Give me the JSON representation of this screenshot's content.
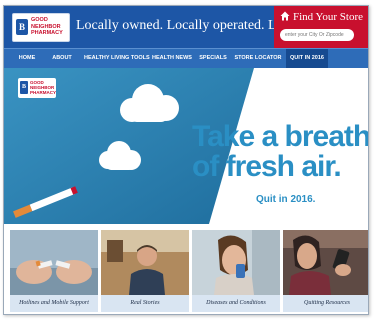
{
  "header": {
    "logo_lines": [
      "GOOD",
      "NEIGHBOR",
      "PHARMACY"
    ],
    "tagline": "Locally owned. Locally operated. Locally loved.",
    "store_finder": {
      "title": "Find Your Store",
      "placeholder": "enter your City Or Zipcode"
    }
  },
  "nav": {
    "items": [
      {
        "label": "HOME"
      },
      {
        "label": "ABOUT"
      },
      {
        "label": "HEALTHY LIVING TOOLS"
      },
      {
        "label": "HEALTH NEWS"
      },
      {
        "label": "SPECIALS"
      },
      {
        "label": "STORE LOCATOR"
      },
      {
        "label": "QUIT IN 2016"
      }
    ],
    "active_index": 6
  },
  "hero": {
    "headline_line1": "Take a breath",
    "headline_line2": "of fresh air.",
    "subline": "Quit in 2016."
  },
  "tiles": [
    {
      "caption": "Hotlines and Mobile Support"
    },
    {
      "caption": "Real Stories"
    },
    {
      "caption": "Diseases and Conditions"
    },
    {
      "caption": "Quitting Resources"
    }
  ],
  "colors": {
    "brand_blue": "#1d56a6",
    "brand_red": "#c8102e",
    "hero_blue": "#2a7fb0",
    "caption_bg": "#d9e5f2"
  }
}
